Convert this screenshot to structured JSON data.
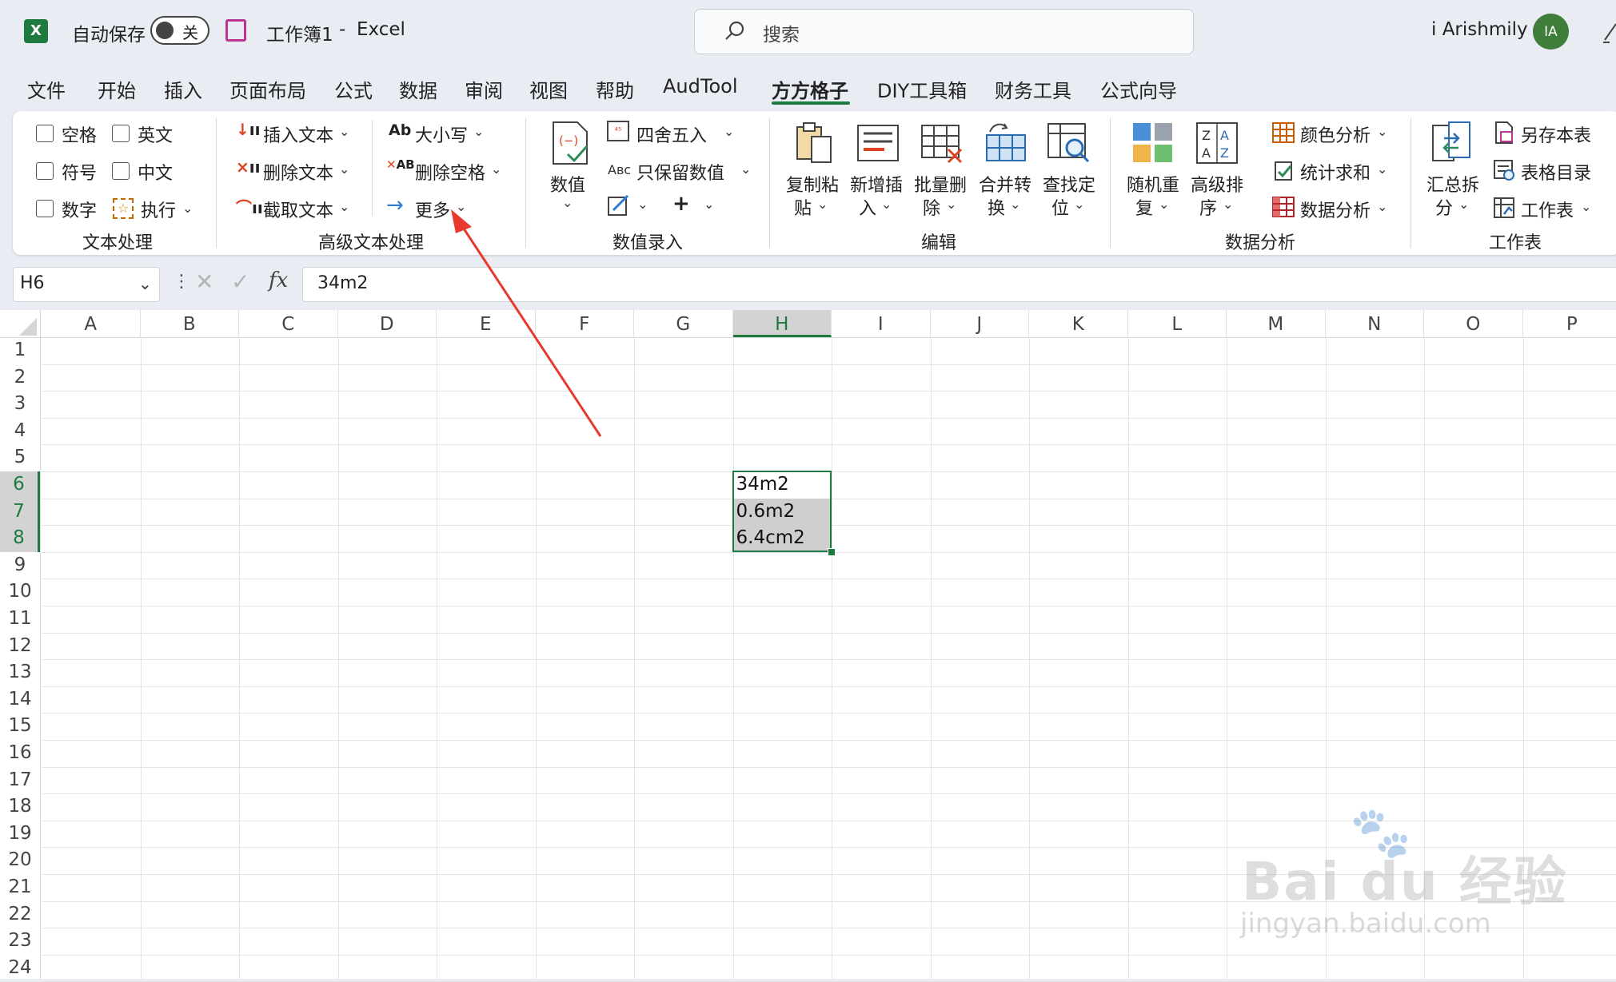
{
  "titlebar": {
    "autosave_label": "自动保存",
    "autosave_state": "关",
    "doc_title": "工作簿1",
    "separator": "-",
    "app_name": "Excel",
    "search_placeholder": "搜索",
    "user_name": "i Arishmily",
    "avatar_initials": "IA"
  },
  "tabs": [
    "文件",
    "开始",
    "插入",
    "页面布局",
    "公式",
    "数据",
    "审阅",
    "视图",
    "帮助",
    "AudTool",
    "方方格子",
    "DIY工具箱",
    "财务工具",
    "公式向导"
  ],
  "active_tab": "方方格子",
  "ribbon": {
    "text_processing": {
      "checkboxes": [
        "空格",
        "英文",
        "符号",
        "中文",
        "数字"
      ],
      "execute": "执行",
      "group_label": "文本处理"
    },
    "advanced_text": {
      "insert_text": "插入文本",
      "delete_text": "删除文本",
      "extract_text": "截取文本",
      "case": "大小写",
      "delete_spaces": "删除空格",
      "more": "更多",
      "group_label": "高级文本处理"
    },
    "numeric_entry": {
      "value": "数值",
      "round": "四舍五入",
      "keep_values": "只保留数值",
      "group_label": "数值录入"
    },
    "edit": {
      "copy_paste": [
        "复制粘",
        "贴"
      ],
      "add_insert": [
        "新增插",
        "入"
      ],
      "batch_delete": [
        "批量删",
        "除"
      ],
      "merge_convert": [
        "合并转",
        "换"
      ],
      "find_locate": [
        "查找定",
        "位"
      ],
      "group_label": "编辑"
    },
    "data_analysis": {
      "random_repeat": [
        "随机重",
        "复"
      ],
      "advanced_sort": [
        "高级排",
        "序"
      ],
      "color_analysis": "颜色分析",
      "stat_sum": "统计求和",
      "data_analysis": "数据分析",
      "group_label": "数据分析"
    },
    "worksheet": {
      "summary_split": [
        "汇总拆",
        "分"
      ],
      "save_as_table": "另存本表",
      "table_directory": "表格目录",
      "worksheet": "工作表",
      "group_label": "工作表"
    }
  },
  "formula_bar": {
    "name_box": "H6",
    "fx": "fx",
    "value": "34m2"
  },
  "columns": [
    "A",
    "B",
    "C",
    "D",
    "E",
    "F",
    "G",
    "H",
    "I",
    "J",
    "K",
    "L",
    "M",
    "N",
    "O",
    "P"
  ],
  "rows": [
    "1",
    "2",
    "3",
    "4",
    "5",
    "6",
    "7",
    "8",
    "9",
    "10",
    "11",
    "12",
    "13",
    "14",
    "15",
    "16",
    "17",
    "18",
    "19",
    "20",
    "21",
    "22",
    "23",
    "24"
  ],
  "cells": {
    "H6": "34m2",
    "H7": "0.6m2",
    "H8": "6.4cm2"
  },
  "active_column": "H",
  "active_rows": [
    "6",
    "7",
    "8"
  ],
  "colors": {
    "accent_green": "#1e7a3f",
    "selection_gray": "#cfcfcf",
    "arrow_red": "#e8392d"
  },
  "watermark": {
    "logo": "Bai du 经验",
    "url": "jingyan.baidu.com"
  }
}
